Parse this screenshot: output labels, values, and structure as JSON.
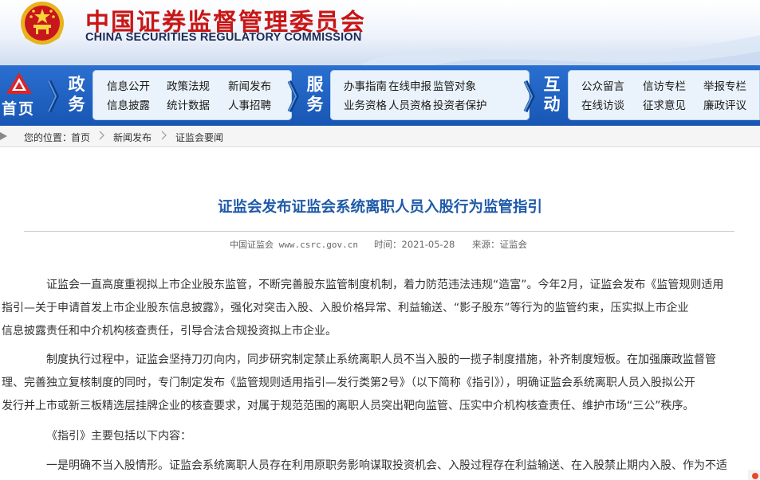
{
  "header": {
    "title_cn": "中国证券监督管理委员会",
    "title_en": "CHINA SECURITIES REGULATORY COMMISSION",
    "emblem_icon": "national-emblem-icon",
    "brand_red": "#c81616",
    "brand_blue": "#1856b4"
  },
  "nav": {
    "home_label": "首页",
    "sections": [
      {
        "label_top": "政",
        "label_bottom": "务",
        "links": [
          "信息公开",
          "政策法规",
          "新闻发布",
          "信息披露",
          "统计数据",
          "人事招聘"
        ]
      },
      {
        "label_top": "服",
        "label_bottom": "务",
        "links": [
          "办事指南",
          "在线申报",
          "监管对象",
          "业务资格",
          "人员资格",
          "投资者保护"
        ]
      },
      {
        "label_top": "互",
        "label_bottom": "动",
        "links": [
          "公众留言",
          "信访专栏",
          "举报专栏",
          "在线访谈",
          "征求意见",
          "廉政评议"
        ]
      }
    ]
  },
  "breadcrumb": {
    "prefix": "您的位置：",
    "items": [
      "首页",
      "新闻发布",
      "证监会要闻"
    ]
  },
  "article": {
    "title": "证监会发布证监会系统离职人员入股行为监管指引",
    "source": "中国证监会 www.csrc.gov.cn",
    "time": "时间：2021-05-28",
    "origin": "来源：证监会",
    "paragraphs": [
      [
        "证监会一直高度重视拟上市企业股东监管，不断完善股东监管制度机制，着力防范违法违规“造富”。今年2月，证监会发布《监管规则适用",
        "指引—关于申请首发上市企业股东信息披露》，强化对突击入股、入股价格异常、利益输送、“影子股东”等行为的监管约束，压实拟上市企业",
        "信息披露责任和中介机构核查责任，引导合法合规投资拟上市企业。"
      ],
      [
        "制度执行过程中，证监会坚持刀刃向内，同步研究制定禁止系统离职人员不当入股的一揽子制度措施，补齐制度短板。在加强廉政监督管",
        "理、完善独立复核制度的同时，专门制定发布《监管规则适用指引—发行类第2号》（以下简称《指引》），明确证监会系统离职人员入股拟公开",
        "发行并上市或新三板精选层挂牌企业的核查要求，对属于规范范围的离职人员突出靶向监管、压实中介机构核查责任、维护市场“三公”秩序。"
      ],
      [
        "《指引》主要包括以下内容："
      ],
      [
        "一是明确不当入股情形。证监会系统离职人员存在利用原职务影响谋取投资机会、入股过程存在利益输送、在入股禁止期内入股、作为不适"
      ]
    ]
  }
}
